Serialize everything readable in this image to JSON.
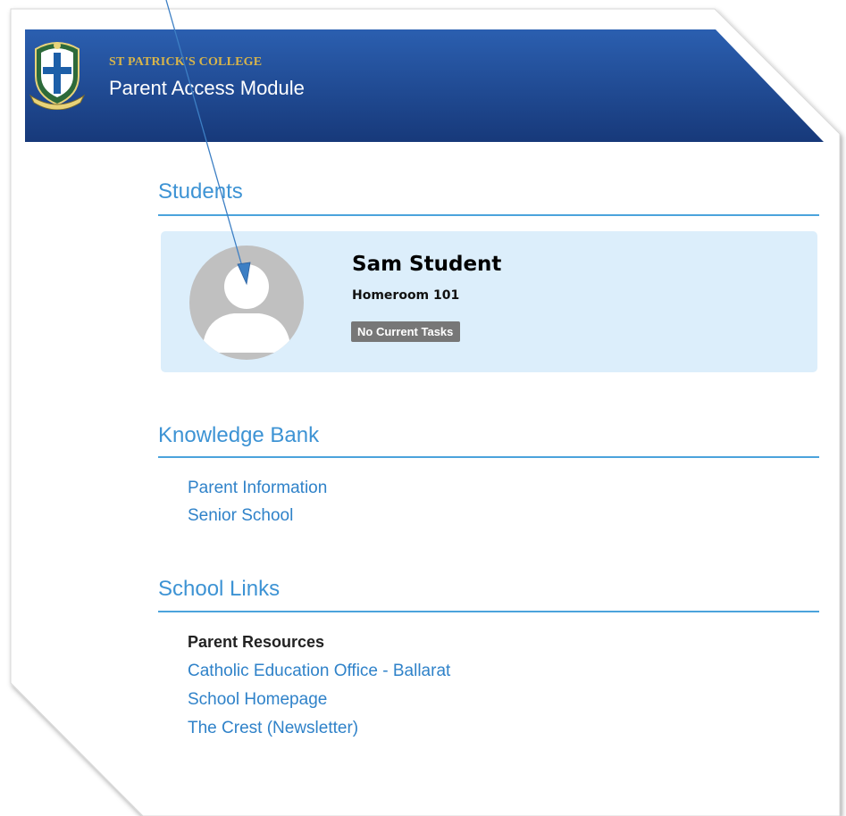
{
  "header": {
    "school_name": "ST PATRICK'S COLLEGE",
    "module_title": "Parent Access Module",
    "crest_icon": "school-crest-icon"
  },
  "students": {
    "title": "Students",
    "cards": [
      {
        "name": "Sam Student",
        "homeroom": "Homeroom 101",
        "badge": "No Current Tasks",
        "avatar_icon": "user-silhouette-icon"
      }
    ]
  },
  "knowledge_bank": {
    "title": "Knowledge Bank",
    "links": [
      "Parent Information",
      "Senior School"
    ]
  },
  "school_links": {
    "title": "School Links",
    "group_heading": "Parent Resources",
    "links": [
      "Catholic Education Office - Ballarat",
      "School Homepage",
      "The Crest (Newsletter)"
    ]
  },
  "colors": {
    "header_blue": "#1f4e9c",
    "accent_blue": "#3d93d4",
    "card_bg": "#dceefb",
    "badge_gray": "#777777",
    "school_name_gold": "#d8b54a"
  }
}
